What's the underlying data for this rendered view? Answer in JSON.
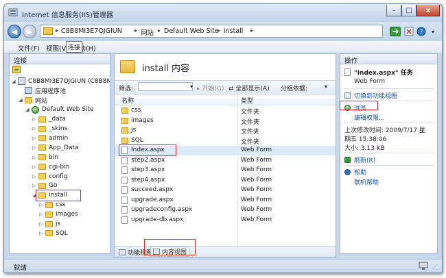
{
  "window": {
    "title": "Internet 信息服务(IIS)管理器",
    "minimize_glyph": "–",
    "maximize_glyph": "□",
    "close_glyph": "x"
  },
  "address": {
    "segments": [
      "C8B8MI3E7QJGIUN",
      "网站",
      "Default Web Site",
      "install"
    ],
    "separator": "▸",
    "back_glyph": "◀",
    "forward_glyph": "▶"
  },
  "toolbar_icons": [
    "refresh-icon",
    "stop-icon",
    "help-icon"
  ],
  "menu": {
    "file": "文件(F)",
    "view": "视图(V)",
    "help": "帮助(H)",
    "tooltip": "连接"
  },
  "connections": {
    "title": "连接",
    "tree": [
      {
        "label": "C8B8MI3E7QJGIUN (C8B8M",
        "depth": 0,
        "icon": "server-icon",
        "twisty": "◢"
      },
      {
        "label": "应用程序池",
        "depth": 1,
        "icon": "app-pool-icon",
        "twisty": ""
      },
      {
        "label": "网站",
        "depth": 1,
        "icon": "folder-icon",
        "twisty": "◢"
      },
      {
        "label": "Default Web Site",
        "depth": 2,
        "icon": "globe-icon",
        "twisty": "◢"
      },
      {
        "label": "_data",
        "depth": 3,
        "icon": "folder-icon",
        "twisty": "▷"
      },
      {
        "label": "_skins",
        "depth": 3,
        "icon": "folder-icon",
        "twisty": "▷"
      },
      {
        "label": "admin",
        "depth": 3,
        "icon": "folder-icon",
        "twisty": "▷"
      },
      {
        "label": "App_Data",
        "depth": 3,
        "icon": "folder-icon",
        "twisty": "▷"
      },
      {
        "label": "bin",
        "depth": 3,
        "icon": "folder-icon",
        "twisty": "▷"
      },
      {
        "label": "cgi-bin",
        "depth": 3,
        "icon": "folder-icon",
        "twisty": "▷"
      },
      {
        "label": "config",
        "depth": 3,
        "icon": "folder-icon",
        "twisty": "▷"
      },
      {
        "label": "Go",
        "depth": 3,
        "icon": "folder-icon",
        "twisty": "▷"
      },
      {
        "label": "install",
        "depth": 3,
        "icon": "folder-icon",
        "twisty": "◢"
      },
      {
        "label": "css",
        "depth": 4,
        "icon": "folder-icon",
        "twisty": "▷"
      },
      {
        "label": "images",
        "depth": 4,
        "icon": "folder-icon",
        "twisty": "▷"
      },
      {
        "label": "js",
        "depth": 4,
        "icon": "folder-icon",
        "twisty": "▷"
      },
      {
        "label": "SQL",
        "depth": 4,
        "icon": "folder-icon",
        "twisty": "▷"
      }
    ]
  },
  "content": {
    "title": "install 内容",
    "filter_label": "筛选:",
    "start_label": "开始(G)",
    "show_all_label": "全部显示(A)",
    "group_label": "分组依据:",
    "col_name": "名称",
    "col_type": "类型",
    "rows": [
      {
        "name": "css",
        "type": "文件夹",
        "icon": "folder-icon"
      },
      {
        "name": "images",
        "type": "文件夹",
        "icon": "folder-icon"
      },
      {
        "name": "js",
        "type": "文件夹",
        "icon": "folder-icon"
      },
      {
        "name": "SQL",
        "type": "文件夹",
        "icon": "folder-icon"
      },
      {
        "name": "Index.aspx",
        "type": "Web Form",
        "icon": "file-icon"
      },
      {
        "name": "step2.aspx",
        "type": "Web Form",
        "icon": "file-icon"
      },
      {
        "name": "step3.aspx",
        "type": "Web Form",
        "icon": "file-icon"
      },
      {
        "name": "step4.aspx",
        "type": "Web Form",
        "icon": "file-icon"
      },
      {
        "name": "succeed.aspx",
        "type": "Web Form",
        "icon": "file-icon"
      },
      {
        "name": "upgrade.aspx",
        "type": "Web Form",
        "icon": "file-icon"
      },
      {
        "name": "upgradeconfig.aspx",
        "type": "Web Form",
        "icon": "file-icon"
      },
      {
        "name": "upgrade-db.aspx",
        "type": "Web Form",
        "icon": "file-icon"
      }
    ],
    "tab_features": "功能视图",
    "tab_content": "内容视图"
  },
  "actions": {
    "title": "操作",
    "item_title": "\"Index.aspx\" 任务",
    "item_type": "Web Form",
    "switch_view": "切换到功能视图",
    "browse": "浏览",
    "edit_perms": "编辑权限...",
    "modified_label": "上次修改时间: 2009/7/17 星",
    "modified_time": "期五 15:38:06",
    "size": "大小: 3.13 KB",
    "refresh": "刷新(R)",
    "help": "帮助",
    "online_help": "联机帮助"
  },
  "status": {
    "text": "就绪"
  },
  "colors": {
    "chrome": "#c7d8ec",
    "link": "#1556a6",
    "highlight": "#d62b2b",
    "selection": "#dbe9f9"
  }
}
